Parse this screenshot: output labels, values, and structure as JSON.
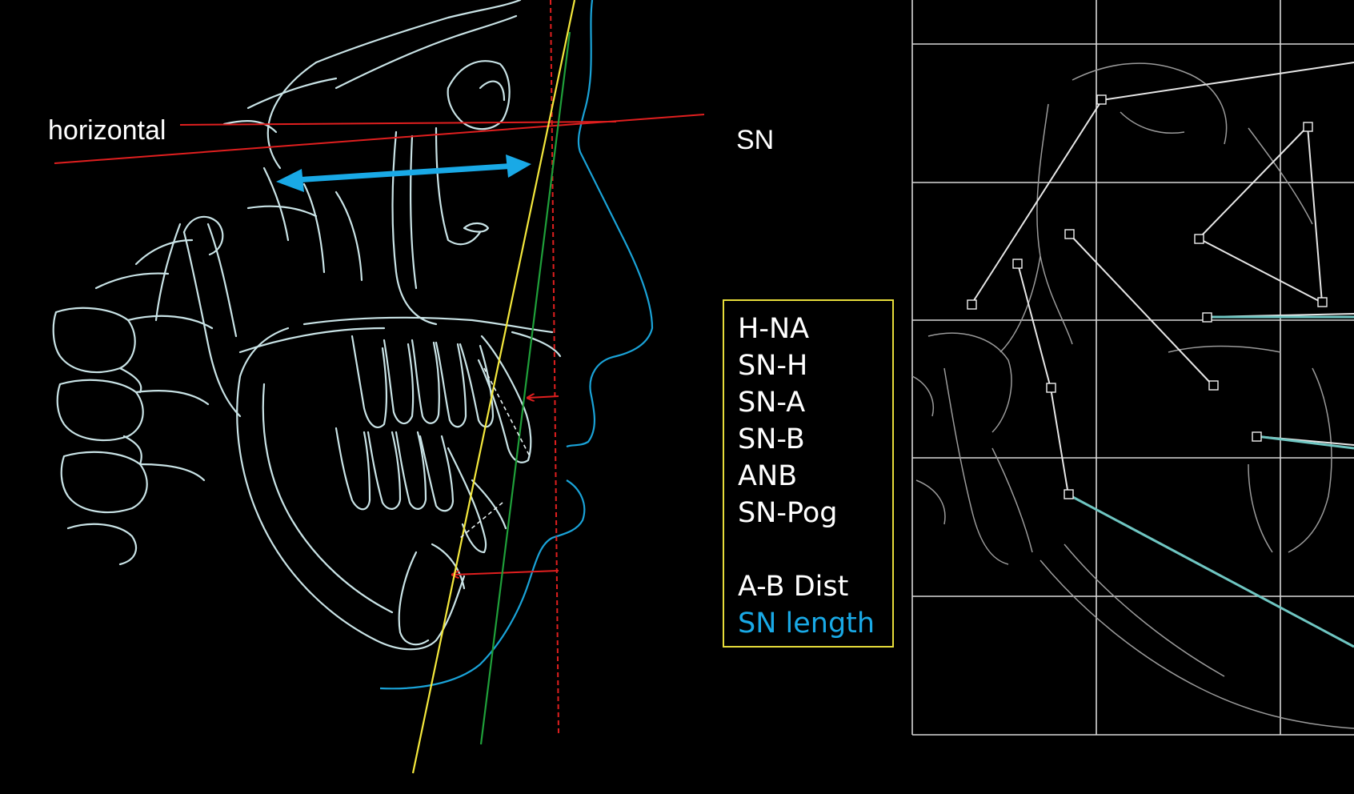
{
  "labels": {
    "horizontal": "horizontal",
    "sn": "SN"
  },
  "legend": {
    "group1": [
      "H-NA",
      "SN-H",
      "SN-A",
      "SN-B",
      "ANB",
      "SN-Pog"
    ],
    "group2": [
      "A-B Dist"
    ],
    "highlight": "SN length"
  },
  "colors": {
    "background": "#000000",
    "tracing": "#c9e3e6",
    "soft_tissue": "#1aa3d8",
    "reference_lines": "#e01f1f",
    "yellow_line": "#f4e83c",
    "green_line": "#1fa03a",
    "sn_length_arrow": "#19a9e6",
    "legend_border": "#e6dc3a",
    "legend_text": "#ffffff",
    "grid": "#d8d8d8",
    "teal_trace": "#6fc6c2"
  }
}
